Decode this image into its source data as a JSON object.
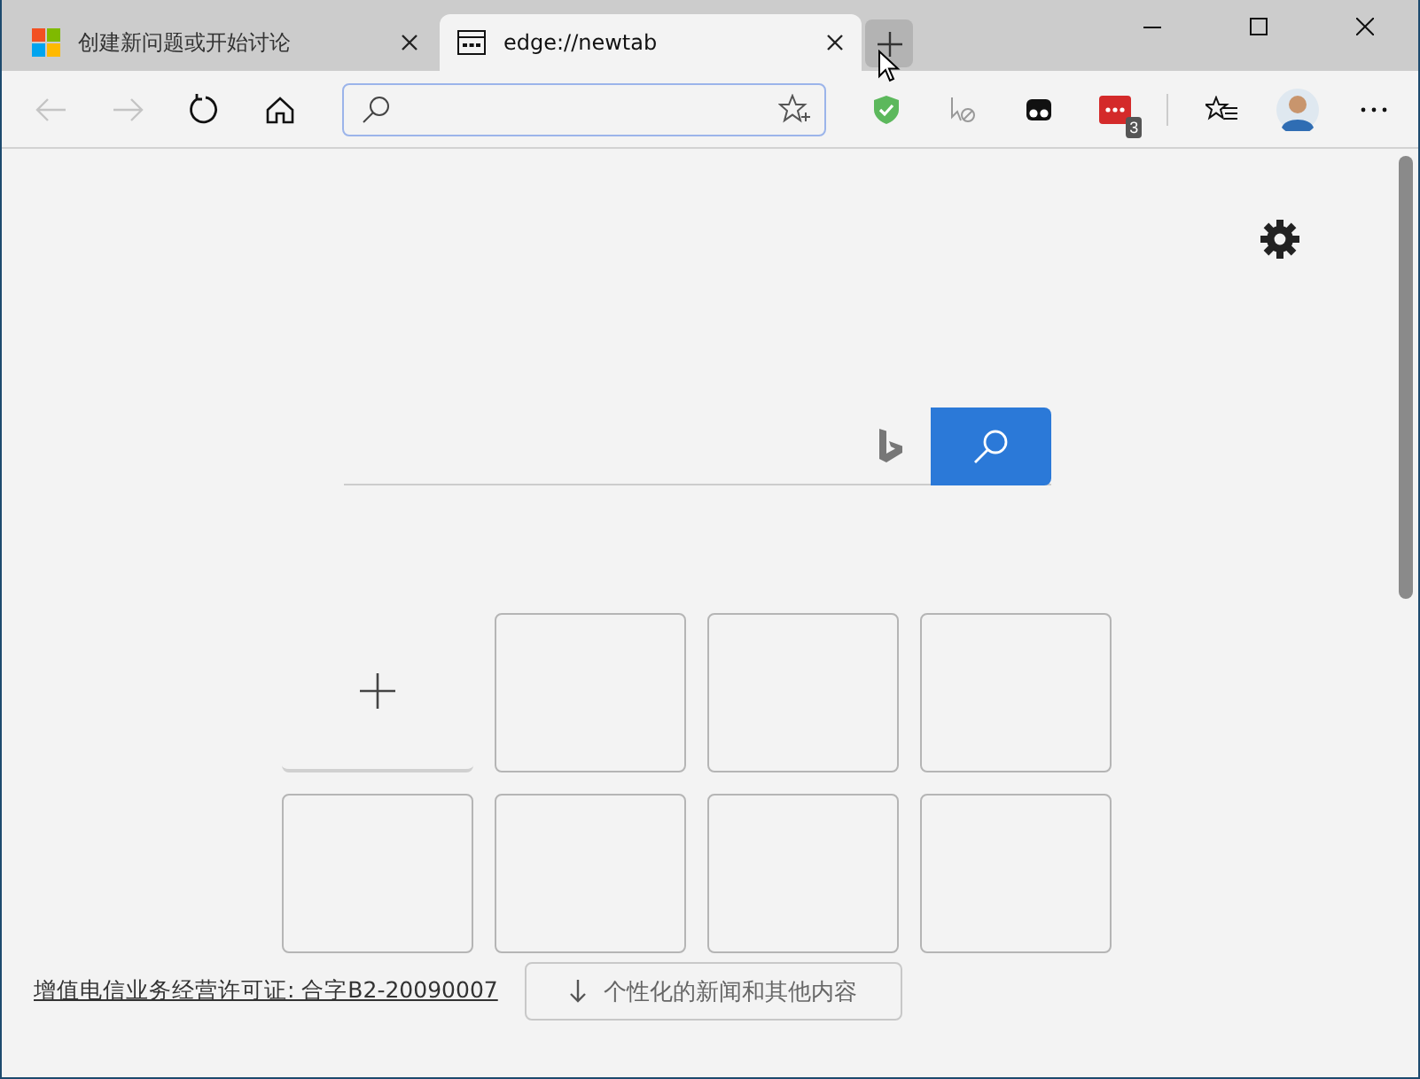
{
  "tabs": [
    {
      "kind": "site",
      "title": "创建新问题或开始讨论",
      "selected": false
    },
    {
      "kind": "newtab",
      "title": "edge://newtab",
      "selected": true
    }
  ],
  "toolbar": {
    "extension_badge": "3"
  },
  "tiles": [
    {
      "kind": "add"
    },
    {
      "kind": "empty"
    },
    {
      "kind": "empty"
    },
    {
      "kind": "empty"
    },
    {
      "kind": "empty"
    },
    {
      "kind": "empty"
    },
    {
      "kind": "empty"
    },
    {
      "kind": "empty"
    }
  ],
  "footer": {
    "license_link": "增值电信业务经营许可证: 合字B2-20090007",
    "feed_button": "个性化的新闻和其他内容"
  }
}
